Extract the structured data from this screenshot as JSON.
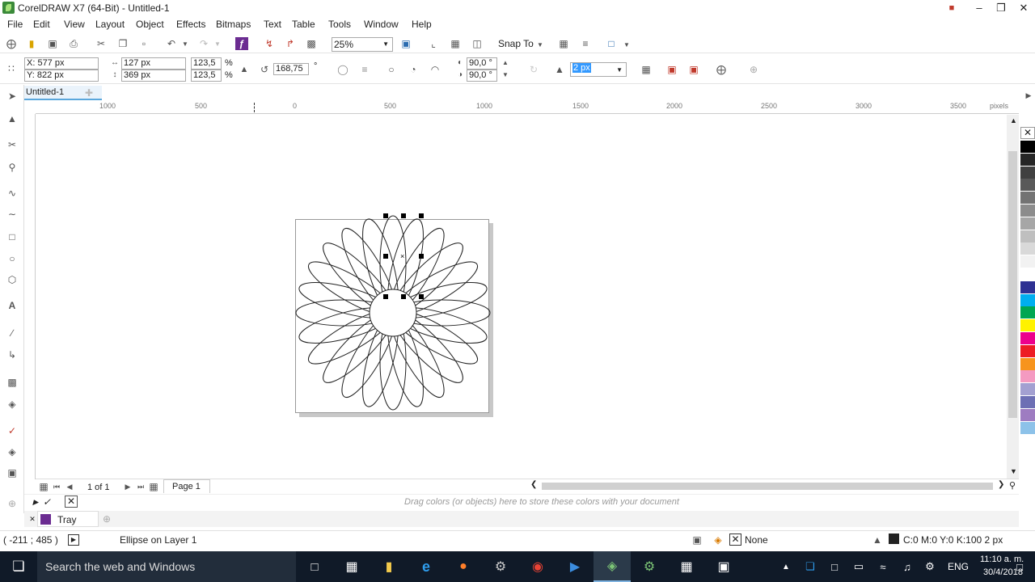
{
  "window": {
    "title": "CorelDRAW X7 (64-Bit) - Untitled-1"
  },
  "menu": [
    "File",
    "Edit",
    "View",
    "Layout",
    "Object",
    "Effects",
    "Bitmaps",
    "Text",
    "Table",
    "Tools",
    "Window",
    "Help"
  ],
  "toolbar": {
    "zoom": "25%",
    "snap_to": "Snap To"
  },
  "propbar": {
    "x": "X: 577 px",
    "y": "Y: 822 px",
    "w": "127 px",
    "h": "369 px",
    "sx": "123,5",
    "sy": "123,5",
    "pct1": "%",
    "pct2": "%",
    "rotation": "168,75",
    "deg": "°",
    "angle1": "90,0 °",
    "angle2": "90,0 °",
    "outline": "2 px"
  },
  "doc_tab": "Untitled-1",
  "ruler": {
    "labels": [
      "1000",
      "500",
      "0",
      "500",
      "1000",
      "1500",
      "2000",
      "2500",
      "3000",
      "3500"
    ],
    "unit": "pixels"
  },
  "pagebar": {
    "count": "1 of 1",
    "page": "Page 1"
  },
  "color_dock_hint": "Drag colors (or objects) here to store these colors with your document",
  "tray": "Tray",
  "status": {
    "coords": "( -211 ; 485  )",
    "info": "Ellipse on Layer 1",
    "fill": "None",
    "outline": "C:0 M:0 Y:0 K:100  2 px"
  },
  "taskbar": {
    "search": "Search the web and Windows",
    "lang": "ENG",
    "time": "11:10 a. m.",
    "date": "30/4/2018"
  },
  "colors": {
    "accent": "#5aa7dc",
    "taskbar": "#101a28"
  },
  "palette": [
    "#000000",
    "#262626",
    "#404040",
    "#595959",
    "#737373",
    "#8c8c8c",
    "#a6a6a6",
    "#bfbfbf",
    "#d9d9d9",
    "#f2f2f2",
    "#ffffff",
    "#2e3192",
    "#00aeef",
    "#00a651",
    "#fff200",
    "#ec008c",
    "#ed1c24",
    "#f7941d",
    "#f49ac1",
    "#a3a0d1",
    "#6d6fb4",
    "#9e7cc1",
    "#8dc2e9"
  ]
}
